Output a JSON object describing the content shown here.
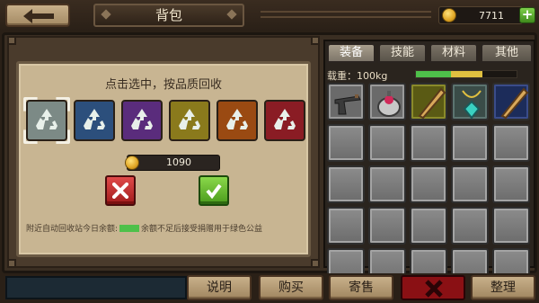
{
  "header": {
    "title": "背包",
    "currency_value": "7711",
    "plus_label": "+"
  },
  "recycle": {
    "instruction": "点击选中，按品质回收",
    "qualities": [
      "white",
      "blue",
      "purple",
      "gold",
      "orange",
      "red"
    ],
    "selected_quality": "white",
    "amount": "1090",
    "notice_before": "附近自动回收站今日余额:",
    "notice_after": "余额不足后接受捐赠用于绿色公益"
  },
  "inventory": {
    "tabs": [
      "装备",
      "技能",
      "材料",
      "其他"
    ],
    "active_tab": "装备",
    "capacity_label": "载重：100kg",
    "capacity_fill": 0.66,
    "items": [
      {
        "icon": "revolver-icon",
        "rarity": "gray"
      },
      {
        "icon": "grenade-icon",
        "rarity": "gray"
      },
      {
        "icon": "baseball-bat-icon",
        "rarity": "olive"
      },
      {
        "icon": "amulet-icon",
        "rarity": "teal"
      },
      {
        "icon": "baseball-bat-icon",
        "rarity": "blue"
      }
    ]
  },
  "footer": {
    "buttons": [
      "说明",
      "购买",
      "寄售",
      "整理"
    ]
  },
  "colors": {
    "accent_green": "#4ec04a",
    "close_red": "#8a1014",
    "parchment": "#c8b592"
  }
}
